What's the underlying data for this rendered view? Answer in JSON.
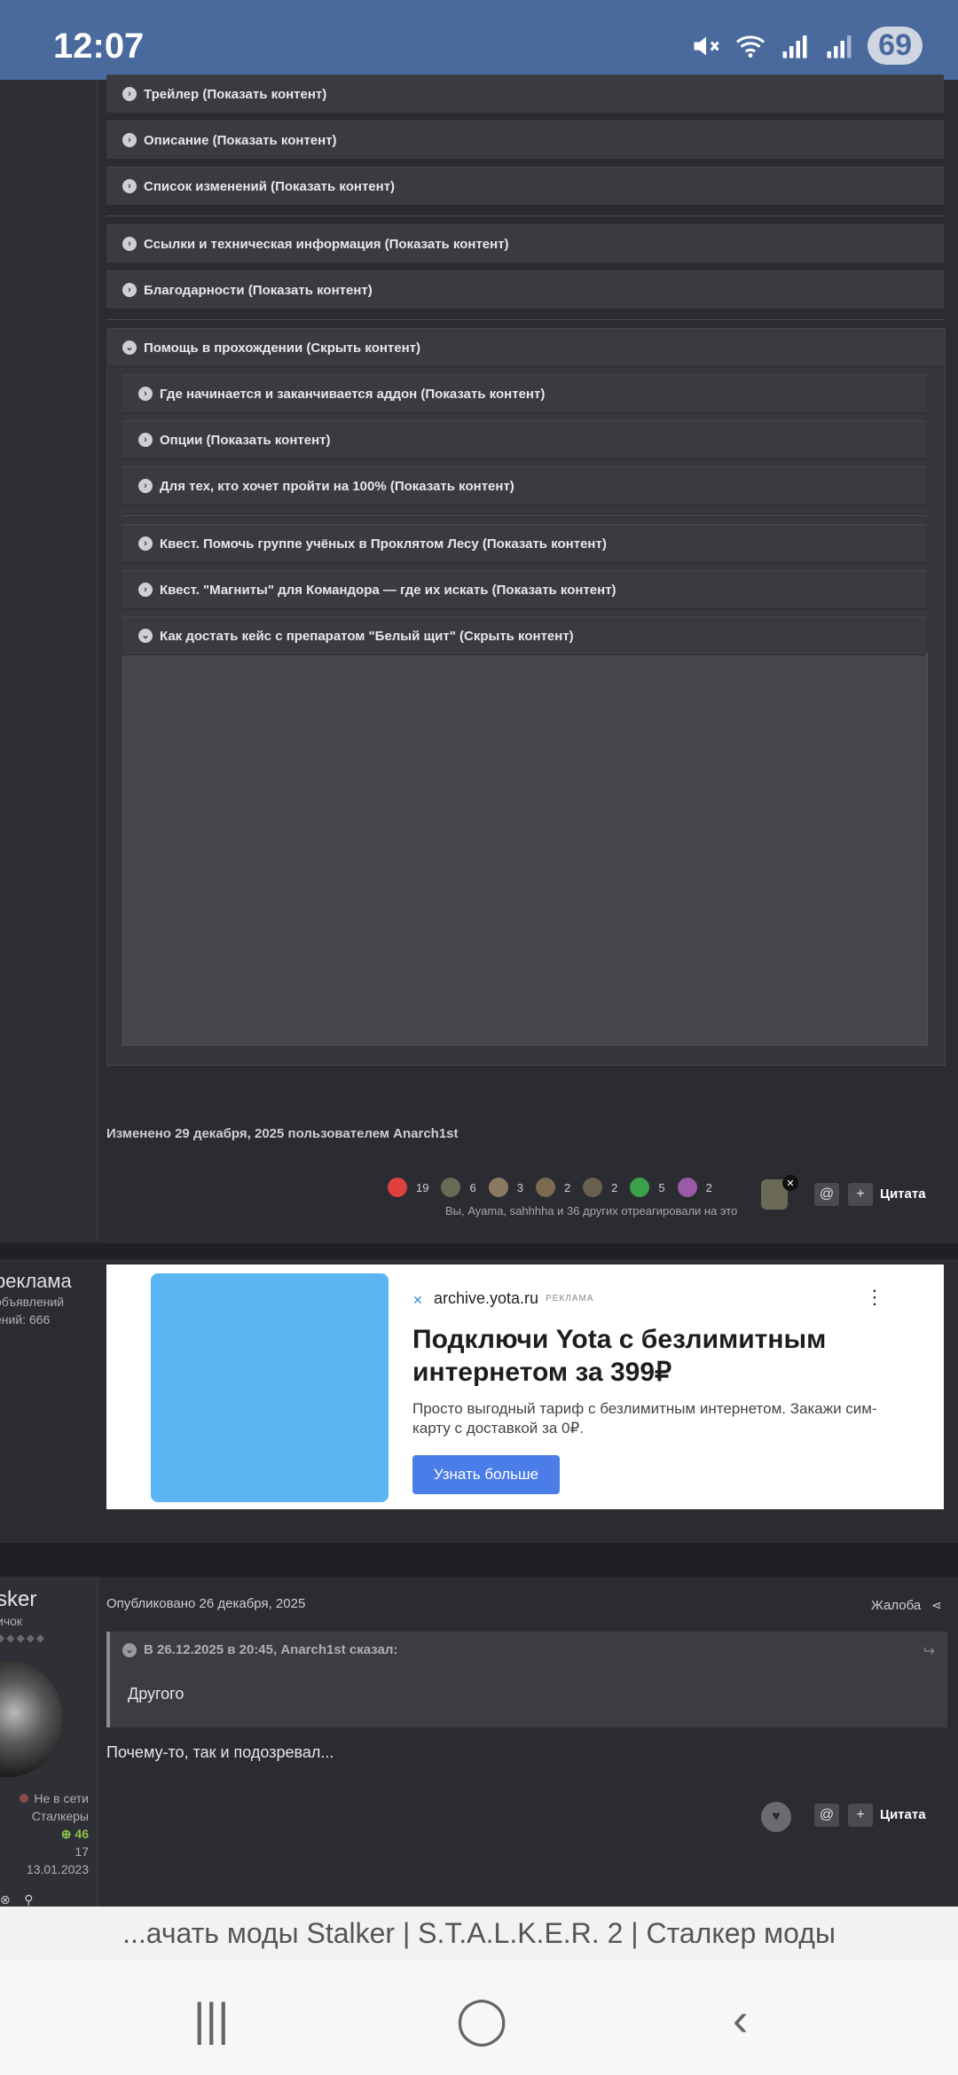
{
  "status": {
    "time": "12:07",
    "battery": "69",
    "signal_label": "5"
  },
  "spoilers": [
    "Трейлер (Показать контент)",
    "Описание (Показать контент)",
    "Список изменений (Показать контент)",
    "Ссылки и техническая информация (Показать контент)",
    "Благодарности (Показать контент)",
    "Помощь в прохождении (Скрыть контент)"
  ],
  "inner_spoilers": [
    "Где начинается и заканчивается аддон (Показать контент)",
    "Опции (Показать контент)",
    "Для тех, кто хочет пройти на 100% (Показать контент)",
    "Квест. Помочь группе учёных в Проклятом Лесу (Показать контент)",
    "Квест. \"Магниты\" для Командора — где их искать (Показать контент)",
    "Как достать кейс с препаратом \"Белый щит\" (Скрыть контент)"
  ],
  "edited_note": "Изменено 29 декабря, 2025 пользователем Anarch1st",
  "reactions": [
    {
      "count": "19",
      "color": "#e04040"
    },
    {
      "count": "6",
      "color": "#6b6a55"
    },
    {
      "count": "3",
      "color": "#8a7a60"
    },
    {
      "count": "2",
      "color": "#7a6a50"
    },
    {
      "count": "2",
      "color": "#6a6050"
    },
    {
      "count": "5",
      "color": "#3aa04a"
    },
    {
      "count": "2",
      "color": "#9a5aa8"
    }
  ],
  "reaction_summary": "Вы, Ayama, sahhhha и 36 других отреагировали на это",
  "quote_label": "Цитата",
  "ad_sidebar": {
    "title": "реклама",
    "line1": "объявлений",
    "line2": "ений: 666"
  },
  "ad": {
    "domain": "archive.yota.ru",
    "tag": "РЕКЛАМА",
    "headline": "Подключи Yota с безлимитным интернетом за 399₽",
    "description": "Просто выгодный тариф с безлимитным интернетом. Закажи сим-карту с доставкой за 0₽.",
    "cta": "Узнать больше",
    "image_color": "#5bb5f3"
  },
  "post": {
    "username": "sker",
    "rank": "ичок",
    "status": "Не в сети",
    "group": "Сталкеры",
    "reputation": "46",
    "posts": "17",
    "joined": "13.01.2023",
    "published": "Опубликовано 26 декабря, 2025",
    "report": "Жалоба",
    "quote_header": "В 26.12.2025 в 20:45, Anarch1st сказал:",
    "quote_body": "Другого",
    "body": "Почему-то, так и подозревал..."
  },
  "browser": {
    "title": "...ачать моды Stalker | S.T.A.L.K.E.R. 2 | Сталкер моды"
  }
}
